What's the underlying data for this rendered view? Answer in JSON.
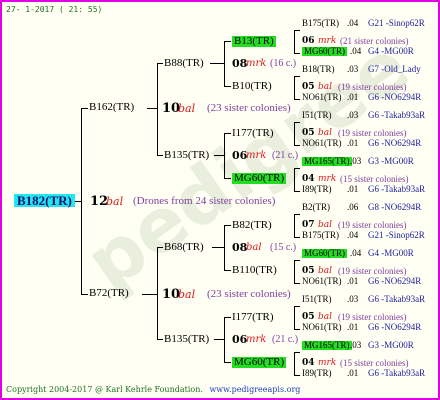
{
  "header": {
    "date": "27- 1-2017 ( 21: 55)"
  },
  "footer": {
    "copyright": "Copyright 2004-2017 @ Karl Kehrle Foundation.",
    "website": "www.pedigreeapis.org"
  },
  "colors": {
    "frame": "#e000e0",
    "highlight_green": "#22dd22",
    "highlight_cyan": "#22e6f0",
    "marker": "#e01818"
  },
  "root": {
    "id": "B182(TR)",
    "num": "12",
    "mark": "bal",
    "note": "(Drones from 24 sister colonies)"
  },
  "gen1": [
    {
      "id": "B162(TR)",
      "num": "10",
      "mark": "bal",
      "note": "(23 sister colonies)"
    },
    {
      "id": "B72(TR)",
      "num": "10",
      "mark": "bal",
      "note": "(23 sister colonies)"
    }
  ],
  "gen2": [
    {
      "id": "B88(TR)",
      "num": "08",
      "mark": "mrk",
      "note": "(16 c.)"
    },
    {
      "id": "B135(TR)",
      "num": "06",
      "mark": "mrk",
      "note": "(21 c.)"
    },
    {
      "id": "B68(TR)",
      "num": "08",
      "mark": "bal",
      "note": "(15 c.)"
    },
    {
      "id": "B135(TR)",
      "num": "06",
      "mark": "mrk",
      "note": "(21 c.)"
    }
  ],
  "gen3": [
    {
      "id": "B13(TR)",
      "num": "06",
      "mark": "mrk",
      "note": "(21 sister colonies)"
    },
    {
      "id": "B10(TR)",
      "num": "05",
      "mark": "bal",
      "note": "(19 sister colonies)"
    },
    {
      "id": "I177(TR)",
      "num": "05",
      "mark": "bal",
      "note": "(19 sister colonies)"
    },
    {
      "id": "MG60(TR)",
      "num": "04",
      "mark": "mrk",
      "note": "(15 sister colonies)"
    },
    {
      "id": "B82(TR)",
      "num": "07",
      "mark": "bal",
      "note": "(19 sister colonies)"
    },
    {
      "id": "B110(TR)",
      "num": "05",
      "mark": "bal",
      "note": "(19 sister colonies)"
    },
    {
      "id": "I177(TR)",
      "num": "05",
      "mark": "bal",
      "note": "(19 sister colonies)"
    },
    {
      "id": "MG60(TR)",
      "num": "04",
      "mark": "mrk",
      "note": "(15 sister colonies)"
    }
  ],
  "gen4": [
    {
      "id": "B175(TR)",
      "num": ".04",
      "code": "G21 -Sinop62R"
    },
    {
      "id": "MG60(TR)",
      "num": ".04",
      "code": "G4 -MG00R"
    },
    {
      "id": "B18(TR)",
      "num": ".03",
      "code": "G7 -Old_Lady"
    },
    {
      "id": "NO61(TR)",
      "num": ".01",
      "code": "G6 -NO6294R"
    },
    {
      "id": "I51(TR)",
      "num": ".03",
      "code": "G6 -Takab93aR"
    },
    {
      "id": "NO61(TR)",
      "num": ".01",
      "code": "G6 -NO6294R"
    },
    {
      "id": "MG165(TR)",
      "num": ".03",
      "code": "G3 -MG00R"
    },
    {
      "id": "I89(TR)",
      "num": ".01",
      "code": "G6 -Takab93aR"
    },
    {
      "id": "B2(TR)",
      "num": ".06",
      "code": "G8 -NO6294R"
    },
    {
      "id": "B175(TR)",
      "num": ".04",
      "code": "G21 -Sinop62R"
    },
    {
      "id": "MG60(TR)",
      "num": ".04",
      "code": "G4 -MG00R"
    },
    {
      "id": "NO61(TR)",
      "num": ".01",
      "code": "G6 -NO6294R"
    },
    {
      "id": "I51(TR)",
      "num": ".03",
      "code": "G6 -Takab93aR"
    },
    {
      "id": "NO61(TR)",
      "num": ".01",
      "code": "G6 -NO6294R"
    },
    {
      "id": "MG165(TR)",
      "num": ".03",
      "code": "G3 -MG00R"
    },
    {
      "id": "I89(TR)",
      "num": ".01",
      "code": "G6 -Takab93aR"
    }
  ]
}
